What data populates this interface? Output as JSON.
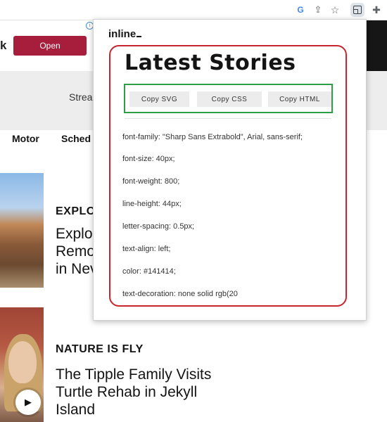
{
  "browser": {
    "toolbar_icons": [
      "google-icon",
      "share-icon",
      "star-icon",
      "extension-active-icon",
      "puzzle-icon"
    ],
    "google_glyph": "G",
    "share_glyph": "⇪",
    "star_glyph": "☆",
    "puzzle_glyph": "✚"
  },
  "site": {
    "ad": {
      "text_fragment": "k",
      "open_label": "Open",
      "info_glyph": "i"
    },
    "stream_link": "Strea",
    "nav": {
      "motor": "Motor",
      "schedule": "Sched"
    },
    "stories": [
      {
        "kicker": "EXPLO",
        "headline_lines": [
          "Explo",
          "Remo",
          "in Nev"
        ]
      },
      {
        "kicker": "NATURE IS FLY",
        "headline_lines": [
          "The Tipple Family Visits",
          "Turtle Rehab in Jekyll",
          "Island"
        ],
        "play_glyph": "▶"
      }
    ]
  },
  "popup": {
    "logo": "inline",
    "preview_title": "Latest Stories",
    "buttons": {
      "copy_svg": "Copy SVG",
      "copy_css": "Copy CSS",
      "copy_html": "Copy HTML"
    },
    "css_properties": [
      "font-family: \"Sharp Sans Extrabold\", Arial, sans-serif;",
      "font-size: 40px;",
      "font-weight: 800;",
      "line-height: 44px;",
      "letter-spacing: 0.5px;",
      "text-align: left;",
      "color: #141414;",
      "text-decoration: none solid rgb(20"
    ]
  },
  "colors": {
    "highlight_red": "#c6262e",
    "highlight_green": "#2e9d45",
    "ad_button": "#a61e3b",
    "text": "#141414"
  }
}
